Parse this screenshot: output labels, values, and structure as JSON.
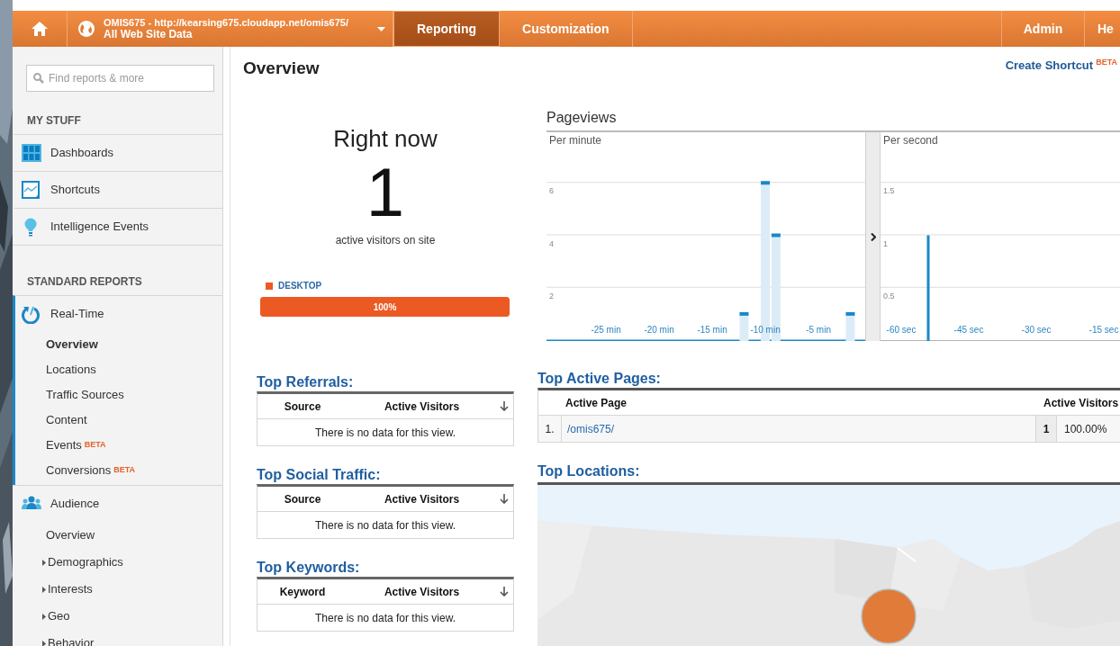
{
  "topbar": {
    "property": {
      "account": "OMIS675 - http://kearsing675.cloudapp.net/omis675/",
      "view": "All Web Site Data"
    },
    "tabs": [
      {
        "label": "Reporting",
        "selected": true
      },
      {
        "label": "Customization",
        "selected": false
      }
    ],
    "right_tabs": [
      "Admin",
      "He"
    ]
  },
  "sidebar": {
    "search": {
      "placeholder": "Find reports & more"
    },
    "sections": [
      {
        "heading": "MY STUFF",
        "items": [
          {
            "label": "Dashboards",
            "selected": false
          },
          {
            "label": "Shortcuts",
            "selected": false
          },
          {
            "label": "Intelligence Events",
            "selected": false
          }
        ]
      },
      {
        "heading": "STANDARD REPORTS",
        "items": [
          {
            "label": "Real-Time",
            "selected": true,
            "children": [
              {
                "label": "Overview",
                "selected": true,
                "expandable": false
              },
              {
                "label": "Locations",
                "selected": false,
                "expandable": false
              },
              {
                "label": "Traffic Sources",
                "selected": false,
                "expandable": false
              },
              {
                "label": "Content",
                "selected": false,
                "expandable": false
              },
              {
                "label": "Events",
                "badge": "BETA",
                "selected": false,
                "expandable": false
              },
              {
                "label": "Conversions",
                "badge": "BETA",
                "selected": false,
                "expandable": false
              }
            ]
          },
          {
            "label": "Audience",
            "selected": false,
            "children": [
              {
                "label": "Overview",
                "selected": false,
                "expandable": false
              },
              {
                "label": "Demographics",
                "selected": false,
                "expandable": true
              },
              {
                "label": "Interests",
                "selected": false,
                "expandable": true
              },
              {
                "label": "Geo",
                "selected": false,
                "expandable": true
              },
              {
                "label": "Behavior",
                "selected": false,
                "expandable": true
              }
            ]
          }
        ]
      }
    ]
  },
  "main": {
    "title": "Overview",
    "shortcut": {
      "label": "Create Shortcut",
      "badge": "BETA"
    },
    "right_now": {
      "title": "Right now",
      "count": "1",
      "caption": "active visitors on site",
      "device": {
        "label": "DESKTOP",
        "color": "#ec5a24",
        "level": 1,
        "reading": "100%"
      }
    },
    "pageviews": {
      "title": "Pageviews",
      "charts": [
        {
          "chart_data": {
            "type": "bar",
            "title": "Per minute",
            "x": [
              -12,
              -10,
              -9,
              -2
            ],
            "values": [
              1,
              6,
              4,
              1
            ],
            "xlim": [
              -30.6,
              -0.6
            ],
            "ylim": [
              0,
              8
            ],
            "grid": true,
            "yticks": [
              2,
              4,
              6
            ],
            "xticks": [
              {
                "value": -25,
                "label": "-25 min"
              },
              {
                "value": -20,
                "label": "-20 min"
              },
              {
                "value": -15,
                "label": "-15 min"
              },
              {
                "value": -10,
                "label": "-10 min"
              },
              {
                "value": -5,
                "label": "-5 min"
              }
            ]
          }
        },
        {
          "chart_data": {
            "type": "bar",
            "title": "Per second",
            "x": [
              -54
            ],
            "values": [
              1
            ],
            "xlim": [
              -64.6,
              -11.2
            ],
            "ylim": [
              0,
              2
            ],
            "grid": true,
            "yticks": [
              0.5,
              1,
              1.5
            ],
            "xticks": [
              {
                "value": -60,
                "label": "-60 sec"
              },
              {
                "value": -45,
                "label": "-45 sec"
              },
              {
                "value": -30,
                "label": "-30 sec"
              },
              {
                "value": -15,
                "label": "-15 sec"
              }
            ]
          }
        }
      ]
    },
    "left_tables": [
      {
        "title": "Top Referrals:",
        "columns": [
          "Source",
          "Active Visitors"
        ],
        "empty": "There is no data for this view."
      },
      {
        "title": "Top Social Traffic:",
        "columns": [
          "Source",
          "Active Visitors"
        ],
        "empty": "There is no data for this view."
      },
      {
        "title": "Top Keywords:",
        "columns": [
          "Keyword",
          "Active Visitors"
        ],
        "empty": "There is no data for this view."
      }
    ],
    "top_active_pages": {
      "title": "Top Active Pages:",
      "columns": [
        "Active Page",
        "Active Visitors"
      ],
      "rows": [
        {
          "index": "1.",
          "page": "/omis675/",
          "visitors": "1",
          "share": "100.00%"
        }
      ]
    },
    "top_locations": {
      "title": "Top Locations:"
    }
  }
}
